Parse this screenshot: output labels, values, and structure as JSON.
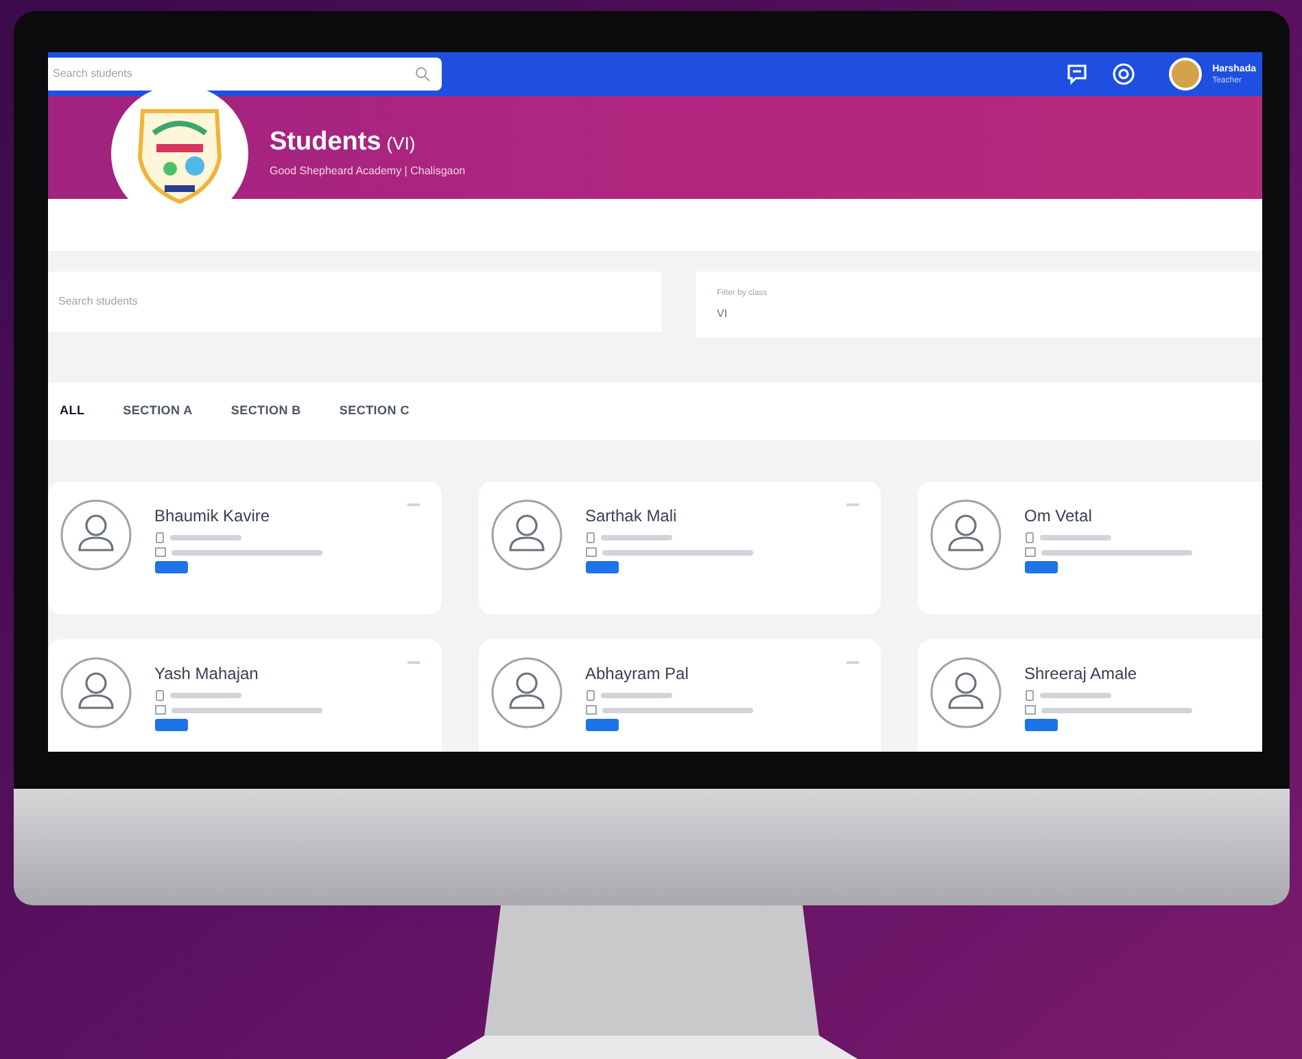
{
  "topbar": {
    "search": {
      "placeholder": "Search students"
    },
    "user": {
      "name": "Harshada",
      "role": "Teacher"
    }
  },
  "banner": {
    "title": "Students",
    "class_label": "(VI)",
    "subtitle": "Good Shepheard Academy | Chalisgaon"
  },
  "filters": {
    "search": {
      "placeholder": "Search students"
    },
    "class_filter": {
      "label": "Filter by class",
      "value": "VI"
    }
  },
  "tabs": [
    {
      "label": "ALL",
      "selected": true
    },
    {
      "label": "SECTION A",
      "selected": false
    },
    {
      "label": "SECTION B",
      "selected": false
    },
    {
      "label": "SECTION C",
      "selected": false
    }
  ],
  "students": [
    {
      "name": "Bhaumik Kavire"
    },
    {
      "name": "Sarthak Mali"
    },
    {
      "name": "Om Vetal"
    },
    {
      "name": "Yash Mahajan"
    },
    {
      "name": "Abhayram Pal"
    },
    {
      "name": "Shreeraj Amale"
    }
  ]
}
